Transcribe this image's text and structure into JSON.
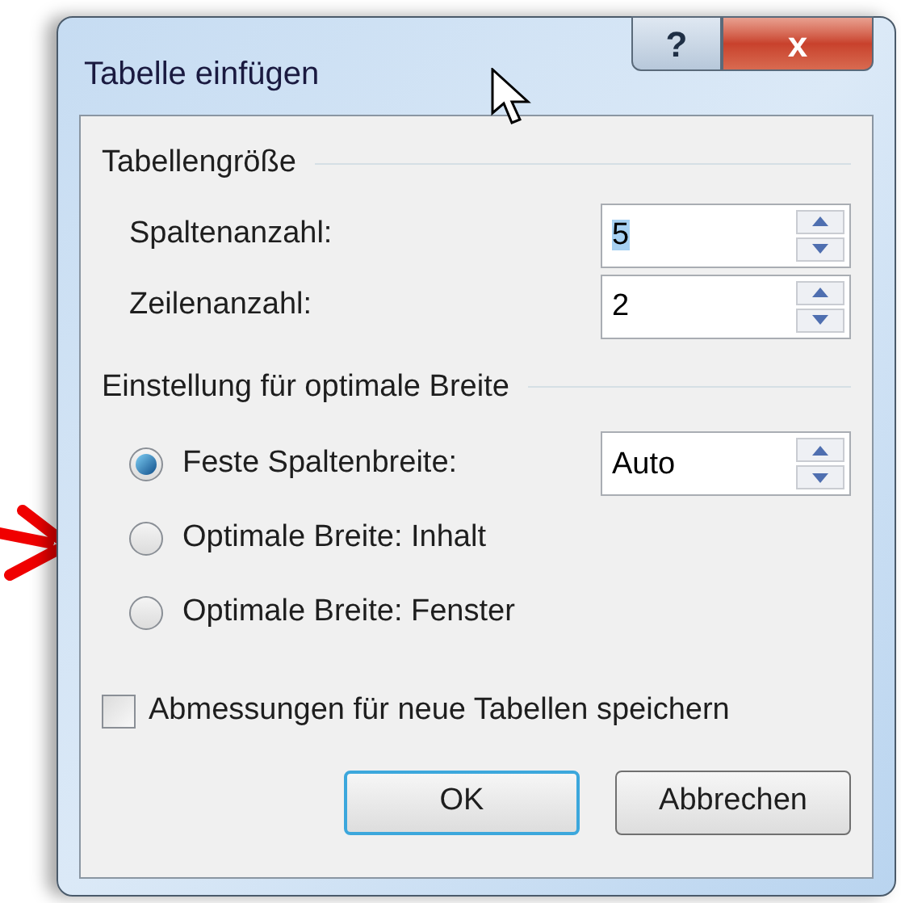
{
  "window": {
    "title": "Tabelle einfügen",
    "title_buttons": [
      "?",
      "x"
    ]
  },
  "size_group": {
    "title": "Tabellengröße",
    "fields": [
      {
        "label": "Spaltenanzahl:",
        "value": "5",
        "selected": true
      },
      {
        "label": "Zeilenanzahl:",
        "value": "2",
        "selected": false
      }
    ]
  },
  "width_group": {
    "title": "Einstellung für optimale Breite",
    "options": [
      {
        "label": "Feste Spaltenbreite:",
        "selected": true,
        "value": "Auto"
      },
      {
        "label": "Optimale Breite: Inhalt",
        "selected": false
      },
      {
        "label": "Optimale Breite: Fenster",
        "selected": false
      }
    ]
  },
  "remember": {
    "label": "Abmessungen für neue Tabellen speichern",
    "checked": false
  },
  "buttons": [
    {
      "label": "OK",
      "kind": "default"
    },
    {
      "label": "Abbrechen",
      "kind": "normal"
    }
  ]
}
